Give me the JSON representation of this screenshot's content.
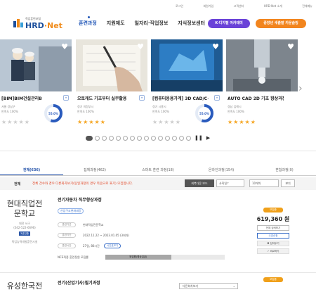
{
  "topnav": [
    "로그인",
    "회원가입",
    "고객센터",
    "HRD-Net 소개",
    "전체메뉴"
  ],
  "logo": {
    "small": "직업훈련포털",
    "main_a": "HRD",
    "main_b": "·Net"
  },
  "menu": [
    "훈련과정",
    "지원제도",
    "일자리·직업정보",
    "지식정보센터"
  ],
  "btn_kdigital": "K-디지털 아카데미",
  "btn_youth": "중장년 새출발 카운슬링",
  "cards": [
    {
      "title": "[BIM]BIM건설관리B",
      "meta1": "서울 강남구",
      "meta2": "만족도 100%",
      "pct": "55.0%",
      "stars": 0,
      "img_color": "#b7c3cf"
    },
    {
      "title": "오토캐드 기초부터 실무활용",
      "meta1": "경기 의정부시",
      "meta2": "만족도 100%",
      "pct": "",
      "stars": 5,
      "img_color": "#d8d5cc"
    },
    {
      "title": "[컴퓨터응용가계] 3D CAD/C~",
      "meta1": "경기 시흥시",
      "meta2": "만족도 100%",
      "pct": "55.0%",
      "stars": 0,
      "img_color": "#2f6fa8"
    },
    {
      "title": "AUTO CAD 2D 기초 향상과정",
      "meta1": "경남 김해시",
      "meta2": "만족도 100%",
      "pct": "",
      "stars": 5,
      "img_color": "#8c949c"
    }
  ],
  "pager": {
    "count": 15,
    "active": 0
  },
  "tabs": [
    "전체(636)",
    "집체과정(462)",
    "스마트 훈련 과정(18)",
    "온라인과정(154)",
    "혼합과정(0)"
  ],
  "filter": {
    "label": "전체",
    "notice": "전체 건수와 경우 다른화자보기(동일과정의 경우 목음으로 표기) 모집합니다.",
    "sel1": "최북다운 보드",
    "sel2": "사직일↑",
    "sel3": "10개씩",
    "btn": "보기"
  },
  "course1": {
    "institution": "현대직업전문학교",
    "inst_line1": "대전 서구",
    "inst_line2": "(042-522-6696)",
    "inst_cert": "3년인증",
    "inst_foot": "직업능력개발훈련시설",
    "title": "전기자동차 직무향상과정",
    "chip": "산업구조변화대응",
    "rows": [
      {
        "label": "훈련기관",
        "value": "현대직업전문학교"
      },
      {
        "label": "훈련기간",
        "value": "2022.11.22 ~ 2023.01.05 (3회차)"
      },
      {
        "label": "훈련시간",
        "value": "27일, 80시간"
      }
    ],
    "pill": "시간표보기",
    "ncs_label": "NCS직종 훈련정원 모집률",
    "gauge_text": "위업룸(예상입금)",
    "gauge_value": 0.55,
    "tag": "모집중",
    "price": "619,360 원",
    "btn1": "전체 검색보기",
    "btn2": "수강신청",
    "btn3": "담아두기",
    "btn4": "비교하기"
  },
  "course2": {
    "institution": "유성한국전",
    "title": "전기(산업기사)필기과정",
    "select": "다른회차보기",
    "tag": "모집중"
  }
}
